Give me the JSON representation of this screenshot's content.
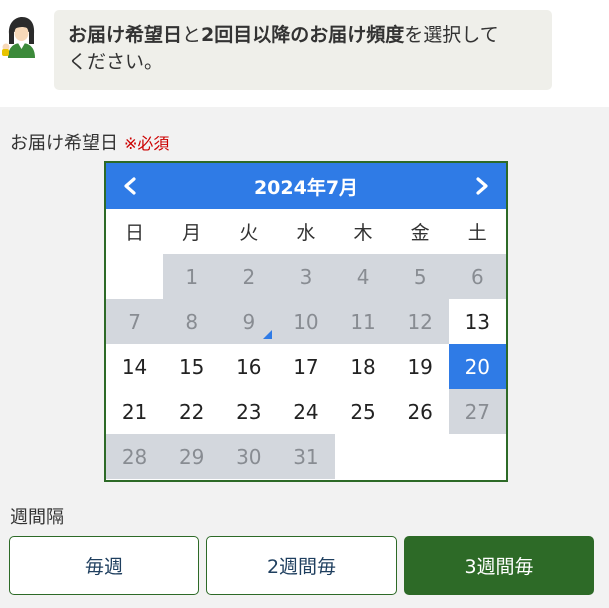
{
  "instruction": {
    "bold1": "お届け希望日",
    "text1": "と",
    "bold2": "2回目以降のお届け頻度",
    "text2": "を選択して",
    "text3": "ください。"
  },
  "delivery_date": {
    "label": "お届け希望日",
    "required": "※必須"
  },
  "calendar": {
    "title": "2024年7月",
    "weekdays": [
      "日",
      "月",
      "火",
      "水",
      "木",
      "金",
      "土"
    ],
    "days": [
      {
        "label": "",
        "state": "empty"
      },
      {
        "label": "1",
        "state": "disabled"
      },
      {
        "label": "2",
        "state": "disabled"
      },
      {
        "label": "3",
        "state": "disabled"
      },
      {
        "label": "4",
        "state": "disabled"
      },
      {
        "label": "5",
        "state": "disabled"
      },
      {
        "label": "6",
        "state": "disabled"
      },
      {
        "label": "7",
        "state": "disabled"
      },
      {
        "label": "8",
        "state": "disabled"
      },
      {
        "label": "9",
        "state": "disabled",
        "today": true
      },
      {
        "label": "10",
        "state": "disabled"
      },
      {
        "label": "11",
        "state": "disabled"
      },
      {
        "label": "12",
        "state": "disabled"
      },
      {
        "label": "13",
        "state": "available"
      },
      {
        "label": "14",
        "state": "available"
      },
      {
        "label": "15",
        "state": "available"
      },
      {
        "label": "16",
        "state": "available"
      },
      {
        "label": "17",
        "state": "available"
      },
      {
        "label": "18",
        "state": "available"
      },
      {
        "label": "19",
        "state": "available"
      },
      {
        "label": "20",
        "state": "selected"
      },
      {
        "label": "21",
        "state": "available"
      },
      {
        "label": "22",
        "state": "available"
      },
      {
        "label": "23",
        "state": "available"
      },
      {
        "label": "24",
        "state": "available"
      },
      {
        "label": "25",
        "state": "available"
      },
      {
        "label": "26",
        "state": "available"
      },
      {
        "label": "27",
        "state": "disabled"
      },
      {
        "label": "28",
        "state": "disabled"
      },
      {
        "label": "29",
        "state": "disabled"
      },
      {
        "label": "30",
        "state": "disabled"
      },
      {
        "label": "31",
        "state": "disabled"
      },
      {
        "label": "",
        "state": "empty"
      },
      {
        "label": "",
        "state": "empty"
      },
      {
        "label": "",
        "state": "empty"
      }
    ]
  },
  "interval": {
    "label": "週間隔",
    "options": [
      "毎週",
      "2週間毎",
      "3週間毎"
    ],
    "selected": "3週間毎"
  },
  "colors": {
    "accent_blue": "#2f7be6",
    "accent_green": "#2d6a27",
    "required_red": "#cc0000"
  },
  "icons": {
    "avatar": "support-staff-icon",
    "prev": "chevron-left-icon",
    "next": "chevron-right-icon"
  }
}
